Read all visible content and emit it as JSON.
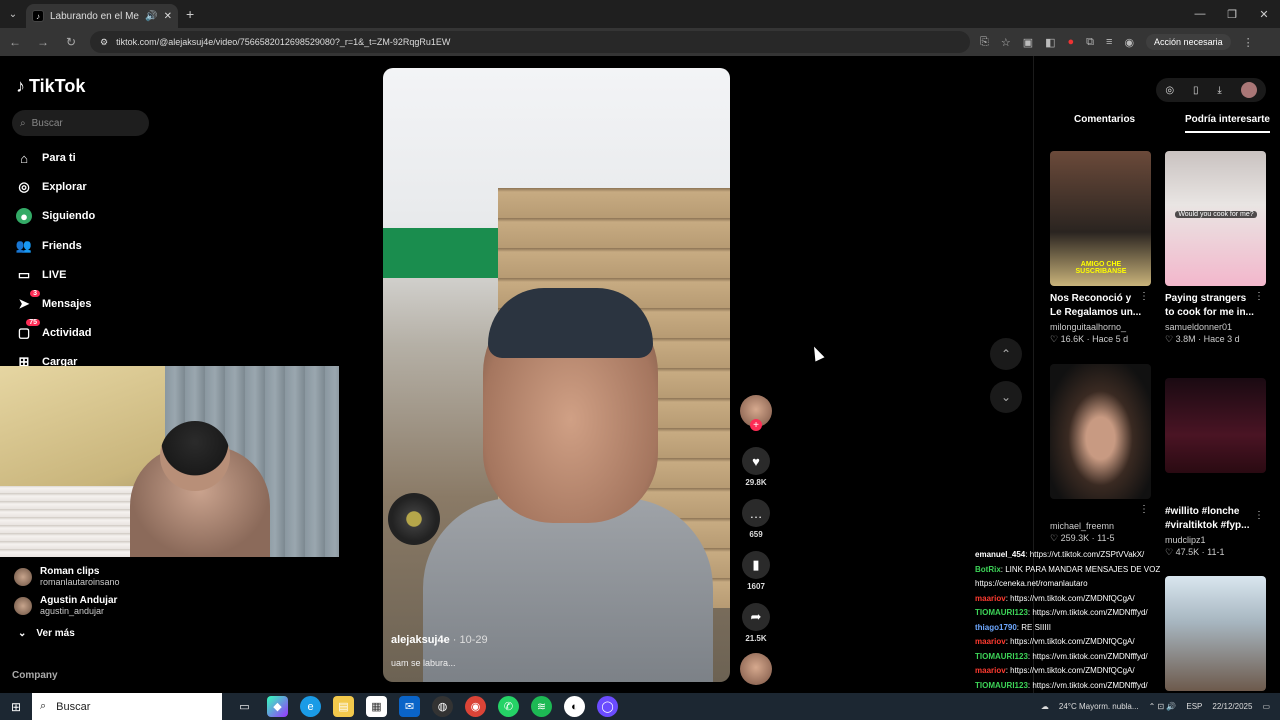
{
  "browser": {
    "tab_title": "Laburando en el Mercado",
    "url": "tiktok.com/@alejaksuj4e/video/7566582012698529080?_r=1&_t=ZM-92RqgRu1EW",
    "action_label": "Acción necesaria"
  },
  "sidebar": {
    "logo": "TikTok",
    "search_placeholder": "Buscar",
    "items": [
      {
        "label": "Para ti"
      },
      {
        "label": "Explorar"
      },
      {
        "label": "Siguiendo"
      },
      {
        "label": "Friends"
      },
      {
        "label": "LIVE"
      },
      {
        "label": "Mensajes",
        "badge": "3"
      },
      {
        "label": "Actividad",
        "badge": "75"
      },
      {
        "label": "Cargar"
      }
    ],
    "following": [
      {
        "name": "Roman clips",
        "user": "romanlautaroinsano"
      },
      {
        "name": "Agustin Andujar",
        "user": "agustin_andujar"
      }
    ],
    "ver_mas": "Ver más",
    "company": "Company"
  },
  "video": {
    "author": "alejaksuj4e",
    "date": "· 10-29",
    "caption": "uam se labura..."
  },
  "actions": {
    "likes": "29.8K",
    "comments": "659",
    "saves": "1607",
    "shares": "21.5K"
  },
  "right_panel": {
    "tab_comments": "Comentarios",
    "tab_interest": "Podría interesarte",
    "cards": [
      {
        "title": "Nos Reconoció y Le Regalamos un...",
        "user": "milonguitaalhorno_",
        "likes": "16.6K",
        "when": "Hace 5 d",
        "overlay": "AMIGO CHE SUSCRIBANSE"
      },
      {
        "title": "Paying strangers to cook for me in...",
        "user": "samueldonner01",
        "likes": "3.8M",
        "when": "Hace 3 d",
        "overlay": "Would you cook for me?"
      },
      {
        "title": "",
        "user": "michael_freemn",
        "likes": "259.3K",
        "when": "11-5"
      },
      {
        "title": "#willito #lonche #viraltiktok #fyp...",
        "user": "mudclipz1",
        "likes": "47.5K",
        "when": "11-1"
      }
    ]
  },
  "chat": [
    {
      "user": "emanuel_454",
      "color": "white",
      "text": ": https://vt.tiktok.com/ZSPtVVakX/"
    },
    {
      "user": "BotRix",
      "color": "green",
      "text": ": LINK PARA MANDAR MENSAJES DE VOZ"
    },
    {
      "user": "",
      "color": "white",
      "text": "https://ceneka.net/romanlautaro"
    },
    {
      "user": "maariov",
      "color": "red",
      "text": ": https://vm.tiktok.com/ZMDNfQCgA/"
    },
    {
      "user": "TIOMAURI123",
      "color": "green",
      "text": ": https://vm.tiktok.com/ZMDNfffyd/"
    },
    {
      "user": "thiago1790",
      "color": "blue",
      "text": ": RE SIIIII"
    },
    {
      "user": "maariov",
      "color": "red",
      "text": ": https://vm.tiktok.com/ZMDNfQCgA/"
    },
    {
      "user": "TIOMAURI123",
      "color": "green",
      "text": ": https://vm.tiktok.com/ZMDNfffyd/"
    },
    {
      "user": "maariov",
      "color": "red",
      "text": ": https://vm.tiktok.com/ZMDNfQCgA/"
    },
    {
      "user": "TIOMAURI123",
      "color": "green",
      "text": ": https://vm.tiktok.com/ZMDNfffyd/"
    }
  ],
  "taskbar": {
    "search": "Buscar",
    "weather": "24°C  Mayorm. nubla...",
    "lang": "ESP",
    "time": "22/12/2025"
  }
}
